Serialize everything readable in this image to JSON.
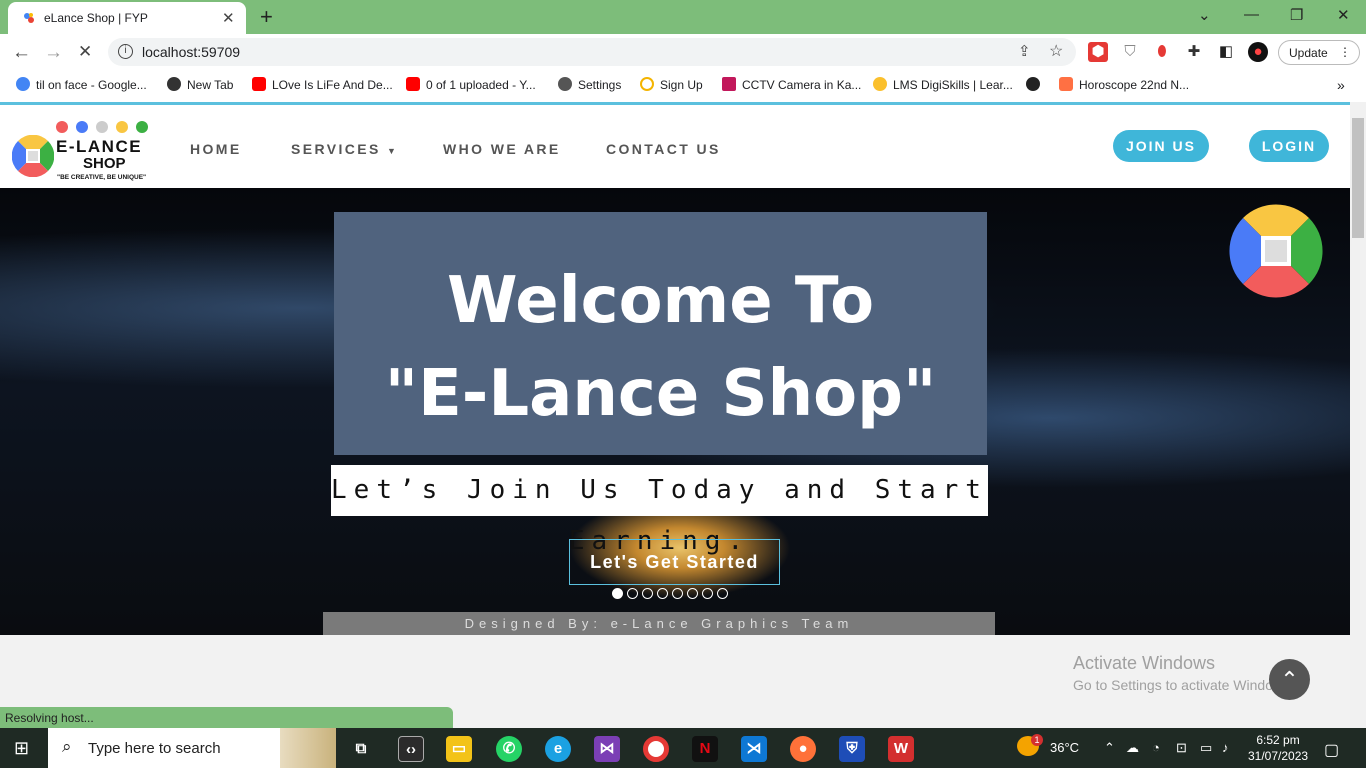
{
  "browser": {
    "tab_title": "eLance Shop | FYP",
    "url": "localhost:59709",
    "update_label": "Update",
    "bookmarks": [
      {
        "label": "til on face - Google...",
        "color": "#4285f4"
      },
      {
        "label": "New Tab",
        "color": "#333333"
      },
      {
        "label": "LOve Is LiFe And De...",
        "color": "#ff0000"
      },
      {
        "label": "0 of 1 uploaded - Y...",
        "color": "#ff0000"
      },
      {
        "label": "Settings",
        "color": "#555555"
      },
      {
        "label": "Sign Up",
        "color": "#f4b400"
      },
      {
        "label": "CCTV Camera in Ka...",
        "color": "#c2185b"
      },
      {
        "label": "LMS DigiSkills | Lear...",
        "color": "#fbc02d"
      },
      {
        "label": "Horoscope 22nd N...",
        "color": "#ff7043"
      }
    ],
    "status_text": "Resolving host..."
  },
  "site": {
    "logo": {
      "line1": "E-LANCE",
      "line2": "SHOP",
      "slogan": "\"BE CREATIVE, BE UNIQUE\""
    },
    "nav": {
      "home": "HOME",
      "services": "SERVICES",
      "who": "WHO WE ARE",
      "contact": "CONTACT US"
    },
    "join_label": "JOIN US",
    "login_label": "LOGIN",
    "hero": {
      "title_line1": "Welcome To",
      "title_line2": "\"E-Lance Shop\"",
      "tagline": "Let’s Join Us Today and Start Earning.",
      "cta": "Let's Get Started",
      "designed_by": "Designed By: e-Lance Graphics Team",
      "slide_count": 8,
      "active_slide": 1
    }
  },
  "windows": {
    "activate_title": "Activate Windows",
    "activate_sub": "Go to Settings to activate Windows.",
    "search_placeholder": "Type here to search",
    "weather": "36°C",
    "weather_badge": "1",
    "time": "6:52 pm",
    "date": "31/07/2023"
  }
}
